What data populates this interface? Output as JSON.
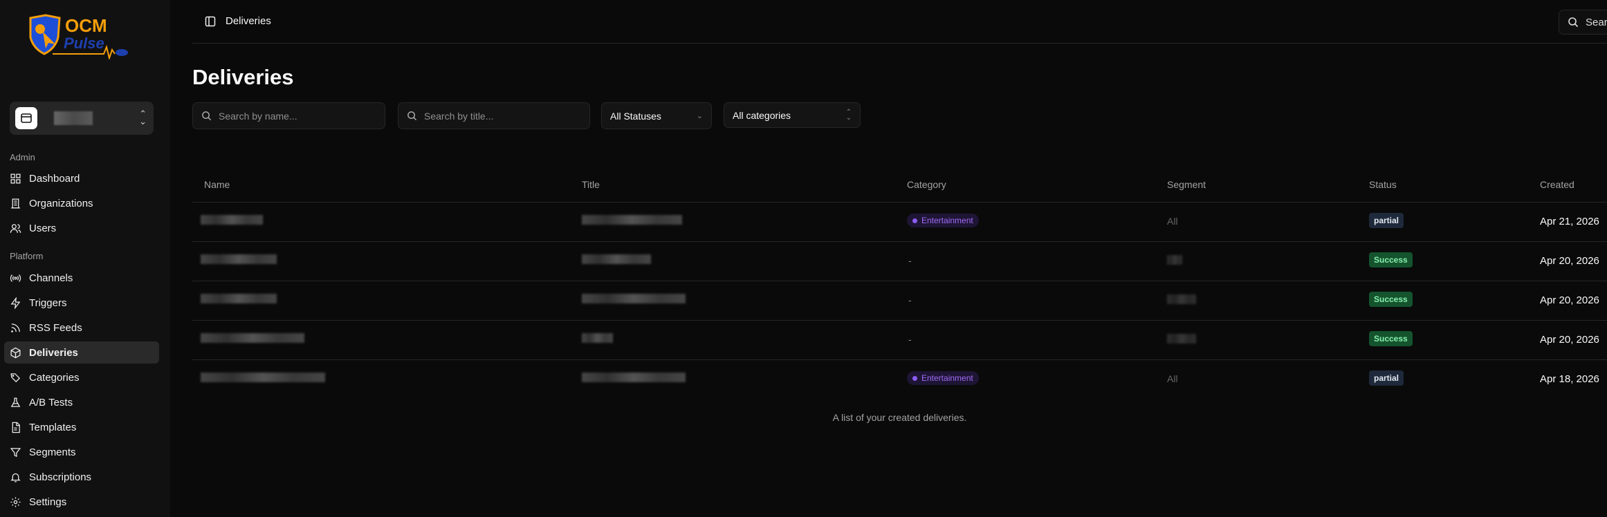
{
  "brand": {
    "logo_text": "OCM Pulse",
    "colors": {
      "orange": "#f59e0b",
      "blue": "#1e40af"
    }
  },
  "sidebar": {
    "groups": [
      {
        "label": "Admin",
        "items": [
          {
            "label": "Dashboard",
            "icon": "layout-grid-icon"
          },
          {
            "label": "Organizations",
            "icon": "building-icon"
          },
          {
            "label": "Users",
            "icon": "users-icon"
          }
        ]
      },
      {
        "label": "Platform",
        "items": [
          {
            "label": "Channels",
            "icon": "radio-icon"
          },
          {
            "label": "Triggers",
            "icon": "zap-icon"
          },
          {
            "label": "RSS Feeds",
            "icon": "rss-icon"
          },
          {
            "label": "Deliveries",
            "icon": "package-icon",
            "active": true
          },
          {
            "label": "Categories",
            "icon": "tags-icon"
          },
          {
            "label": "A/B Tests",
            "icon": "flask-icon"
          },
          {
            "label": "Templates",
            "icon": "file-text-icon"
          },
          {
            "label": "Segments",
            "icon": "filter-icon"
          },
          {
            "label": "Subscriptions",
            "icon": "bell-icon"
          },
          {
            "label": "Settings",
            "icon": "gear-icon"
          }
        ]
      }
    ]
  },
  "header": {
    "breadcrumb": "Deliveries",
    "search_label": "Search"
  },
  "page": {
    "title": "Deliveries"
  },
  "filters": {
    "name_placeholder": "Search by name...",
    "title_placeholder": "Search by title...",
    "status_value": "All Statuses",
    "category_value": "All categories"
  },
  "table": {
    "columns": [
      "Name",
      "Title",
      "Category",
      "Segment",
      "Status",
      "Created"
    ],
    "rows": [
      {
        "category": "Entertainment",
        "segment": "All",
        "status": "partial",
        "created": "Apr 21, 2026"
      },
      {
        "category": "-",
        "segment": "",
        "status": "Success",
        "created": "Apr 20, 2026"
      },
      {
        "category": "-",
        "segment": "",
        "status": "Success",
        "created": "Apr 20, 2026"
      },
      {
        "category": "-",
        "segment": "",
        "status": "Success",
        "created": "Apr 20, 2026"
      },
      {
        "category": "Entertainment",
        "segment": "All",
        "status": "partial",
        "created": "Apr 18, 2026"
      }
    ],
    "caption": "A list of your created deliveries."
  }
}
